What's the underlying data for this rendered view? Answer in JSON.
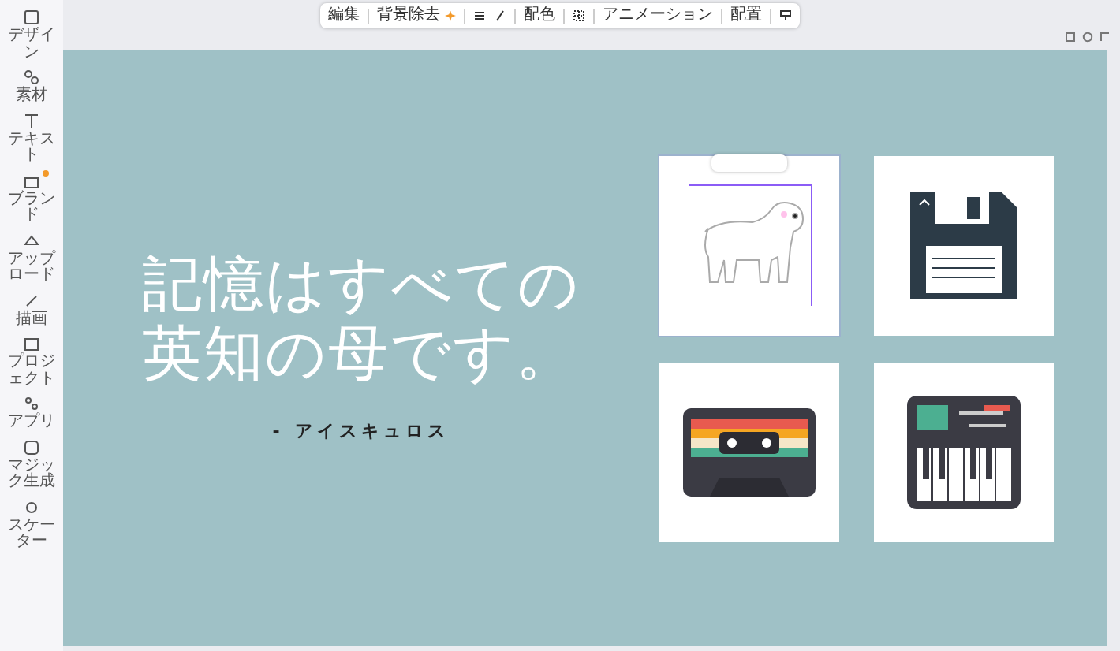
{
  "sidebar": {
    "items": [
      {
        "label": "デザイン",
        "badge": false
      },
      {
        "label": "素材",
        "badge": false
      },
      {
        "label": "テキスト",
        "badge": false
      },
      {
        "label": "ブランド",
        "badge": true
      },
      {
        "label": "アップロード",
        "badge": false
      },
      {
        "label": "描画",
        "badge": false
      },
      {
        "label": "プロジェクト",
        "badge": false
      },
      {
        "label": "アプリ",
        "badge": false
      },
      {
        "label": "マジック生成",
        "badge": false
      },
      {
        "label": "スケーター",
        "badge": false
      }
    ]
  },
  "toolbar": {
    "items": [
      {
        "kind": "text",
        "label": "編集"
      },
      {
        "kind": "sparkle",
        "label": "背景除去"
      },
      {
        "kind": "lines"
      },
      {
        "kind": "pen"
      },
      {
        "kind": "text",
        "label": "配色"
      },
      {
        "kind": "grid"
      },
      {
        "kind": "text",
        "label": "アニメーション"
      },
      {
        "kind": "text",
        "label": "配置"
      },
      {
        "kind": "paint"
      }
    ]
  },
  "slide": {
    "quote": [
      "記憶はすべての",
      "英知の母です。"
    ],
    "author": "- アイスキュロス",
    "images": [
      {
        "kind": "dog",
        "selected": true
      },
      {
        "kind": "floppy",
        "selected": false
      },
      {
        "kind": "cassette",
        "selected": false
      },
      {
        "kind": "synth",
        "selected": false
      }
    ]
  }
}
